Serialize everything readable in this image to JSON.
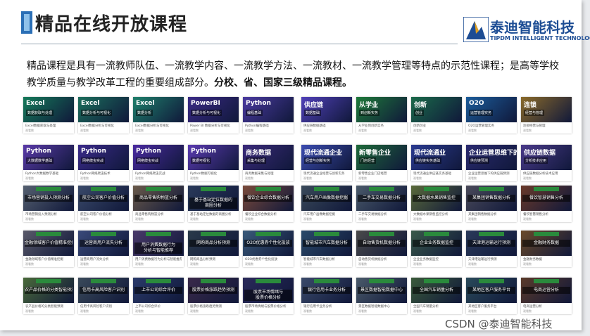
{
  "header": {
    "title": "精品在线开放课程",
    "logo_cn": "泰迪智能科技",
    "logo_en": "TIPDM INTELLIGENT TECHNOLOGY"
  },
  "intro": {
    "line1": "精品课程是具有一流教师队伍、一流教学内容、一流教学方法、一流教材、一流教学管理等特点的示范性课程；是高等学校",
    "line2_normal": "教学质量与教学改革工程的重要组成部分。",
    "line2_bold": "分校、省、国家三级精品课程。"
  },
  "colors": {
    "brand_blue": "#1d4d94",
    "title_bar": "#2b6fb6",
    "case_badge": "#2a8a3c"
  },
  "rows": [
    [
      {
        "title": "Excel",
        "sub": "数据获取与处理",
        "cap": "Excel数据获取与处理",
        "bg": "#157a5a"
      },
      {
        "title": "Excel",
        "sub": "数据分析与可视化",
        "cap": "Excel数据分析与可视化",
        "bg": "#1b6e5c"
      },
      {
        "title": "Excel",
        "sub": "数据分析",
        "cap": "Excel数据分析与可视化",
        "bg": "#1e7f6b"
      },
      {
        "title": "PowerBI",
        "sub": "数据分析与可视化",
        "cap": "Power BI 数据分析与可视化",
        "bg": "#3a2a86"
      },
      {
        "title": "Python",
        "sub": "编程基础",
        "cap": "Python编程基础",
        "bg": "#4a3aa0"
      },
      {
        "title": "供应链",
        "sub": "数据基础",
        "cap": "供应链数据基础",
        "bg": "#5040b8"
      },
      {
        "title": "从学业",
        "sub": "到创新实务",
        "cap": "从学业到创新实务",
        "bg": "#1e7a3a"
      },
      {
        "title": "创新",
        "sub": "创业",
        "cap": "创新创业",
        "bg": "#1a6a4a"
      },
      {
        "title": "O2O",
        "sub": "运营管理实务",
        "cap": "O2O运营管理实务",
        "bg": "#1b5c9a"
      },
      {
        "title": "连锁",
        "sub": "经营与管理",
        "cap": "连锁经营与管理",
        "bg": "#8a6a2a"
      }
    ],
    [
      {
        "title": "Python",
        "sub": "大数据数学基础",
        "cap": "Python大数据数学基础",
        "bg": "#5a3aa8"
      },
      {
        "title": "Python",
        "sub": "网络爬虫实战",
        "cap": "Python网络爬虫技术",
        "bg": "#3a2a8a"
      },
      {
        "title": "Python",
        "sub": "网络爬虫实战",
        "cap": "Python网络爬虫实战",
        "bg": "#4a2aa0"
      },
      {
        "title": "Python",
        "sub": "数据可视化",
        "cap": "Python数据可视化",
        "bg": "#5a3ab0"
      },
      {
        "title": "商务数据",
        "sub": "采集与处理",
        "cap": "商务数据采集与处理",
        "bg": "#3a2a7a"
      },
      {
        "title": "现代流通企业",
        "sub": "经营与创新实务",
        "cap": "现代流通企业经营与创新实务",
        "bg": "#3b4cb0"
      },
      {
        "title": "新零售企业",
        "sub": "门店经营",
        "cap": "新零售企业门店经营",
        "bg": "#1e6a3a"
      },
      {
        "title": "现代流通业",
        "sub": "供应链实务基础",
        "cap": "现代流通业供应链实务基础",
        "bg": "#2a3a90"
      },
      {
        "title": "企业运营思维下的",
        "sub": "供应链预测",
        "cap": "企业运营思维下的供应链预测",
        "bg": "#2a2a70"
      },
      {
        "title": "供应链数据",
        "sub": "分析技术应用",
        "cap": "供应链数据分析技术应用",
        "bg": "#4a3a8a"
      }
    ],
    [
      {
        "case": "市场营销投入预测分析",
        "cap": "市场营销投入预测分析",
        "bg": "#556070"
      },
      {
        "case": "航空公司客户价值分析",
        "cap": "航空公司客户价值分析",
        "bg": "#3a4a6a"
      },
      {
        "case": "商品零售购物篮分析",
        "cap": "商品零售购物篮分析",
        "bg": "#6a5a4a"
      },
      {
        "case": "基于基站定位数据的",
        "case2": "商圈分析",
        "cap": "基于基站定位数据的商圈分析",
        "bg": "#2a3a5a"
      },
      {
        "case": "餐饮企业综合数据分析",
        "cap": "餐饮企业综合数据分析",
        "bg": "#7a4a3a"
      },
      {
        "case": "汽车用户画像数据挖掘",
        "cap": "汽车用户画像数据挖掘",
        "bg": "#3a4a5a"
      },
      {
        "case": "二手车交易数据分析",
        "cap": "二手车交易数据分析",
        "bg": "#4a5a6a"
      },
      {
        "case": "大数据水果销售监控",
        "cap": "大数据水果销售监控分析",
        "bg": "#5a6a3a"
      },
      {
        "case": "某集团销售数据分析",
        "cap": "某集团销售数据分析",
        "bg": "#4a4a5a"
      },
      {
        "case": "餐饮智慧销售分析",
        "cap": "餐饮智慧销售分析",
        "bg": "#6a3a2a"
      }
    ],
    [
      {
        "case": "金融领域客户价值精准挖掘",
        "cap": "金融领域客户价值精准挖掘",
        "bg": "#5a5a6a"
      },
      {
        "case": "运营商用户流失分析",
        "cap": "运营商用户流失分析",
        "bg": "#3a4a7a"
      },
      {
        "case": "用户消费数据行为",
        "case2": "分析与智能推荐",
        "cap": "用户消费数据行为分析与智能推荐",
        "bg": "#4a3a6a"
      },
      {
        "case": "网购商品分析预测",
        "cap": "网购商品分析预测",
        "bg": "#2a3a4a"
      },
      {
        "case": "O2O优惠券个性化投放",
        "cap": "O2O优惠券个性化投放",
        "bg": "#3a5a7a"
      },
      {
        "case": "智能城市汽车数据分析",
        "cap": "智能城市汽车数据分析",
        "bg": "#2a4a6a"
      },
      {
        "case": "自动售货机数据分析",
        "cap": "自动售货机数据分析",
        "bg": "#4a4a4a"
      },
      {
        "case": "企业业务数据监控",
        "cap": "企业业务数据监控",
        "bg": "#3a5a4a"
      },
      {
        "case": "天津港运输运行预测",
        "cap": "天津港运输运行预测",
        "bg": "#2a3a5a"
      },
      {
        "case": "金融财务数据",
        "cap": "金融财务数据",
        "bg": "#6a4a2a"
      }
    ],
    [
      {
        "case": "农产品价格的分类智能预测",
        "cap": "农产品价格的分类智能预测",
        "bg": "#4a6a3a"
      },
      {
        "case": "信用卡高风险客户识别",
        "cap": "信用卡高风险客户识别",
        "bg": "#3a4a5a"
      },
      {
        "case": "上市公司综合评价",
        "cap": "上市公司综合评价",
        "bg": "#2a3a6a"
      },
      {
        "case": "股票价格涨跌趋势预测",
        "cap": "股票价格涨跌趋势预测",
        "bg": "#3a2a4a"
      },
      {
        "case": "股票市场情绪与",
        "case2": "股票价格分析",
        "cap": "股票市场情绪与股票价格分析",
        "bg": "#2a2a5a"
      },
      {
        "case": "银行信用卡业务分析",
        "cap": "银行信用卡业务分析",
        "bg": "#3a4a6a"
      },
      {
        "case": "景区数据智能数据中心",
        "cap": "景区数据智能数据中心",
        "bg": "#4a5a6a"
      },
      {
        "case": "全国汽车销量分析",
        "cap": "全国汽车销量分析",
        "bg": "#3a5a3a"
      },
      {
        "case": "某地区客户服务平台",
        "cap": "某地区客户服务平台",
        "bg": "#2a4a5a"
      },
      {
        "case": "电商运营分析",
        "cap": "电商运营分析",
        "bg": "#5a3a2a"
      }
    ]
  ],
  "card_meta": "观看数",
  "watermark": "CSDN @泰迪智能科技"
}
